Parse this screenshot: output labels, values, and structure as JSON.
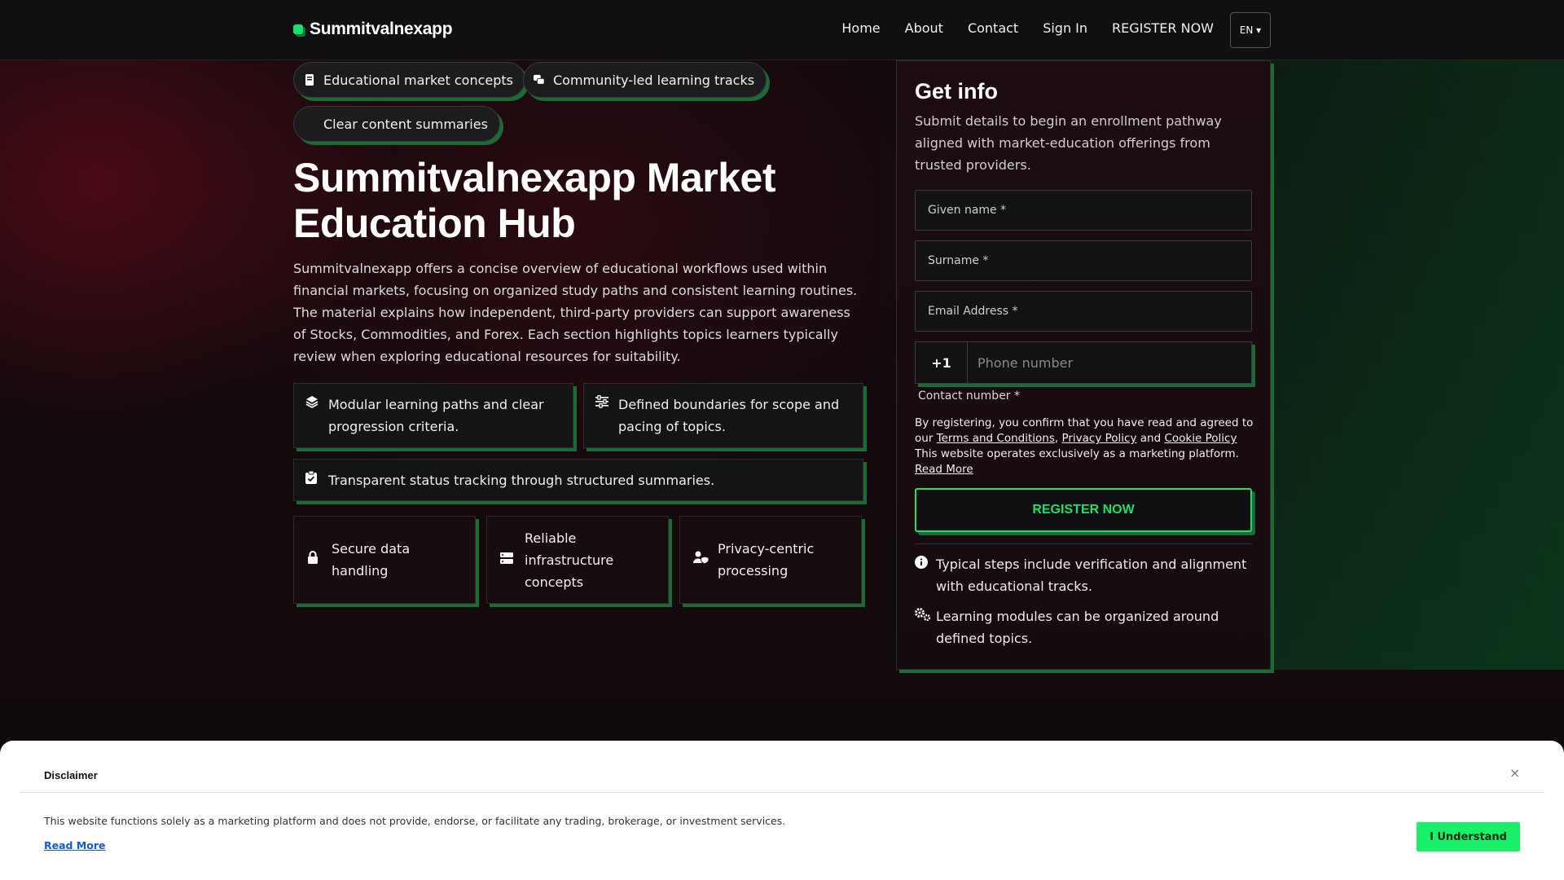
{
  "header": {
    "brand": "Summitvalnexapp",
    "nav": [
      "Home",
      "About",
      "Contact",
      "Sign In",
      "REGISTER NOW"
    ],
    "lang": "EN ▾"
  },
  "chips": [
    {
      "label": "Educational market concepts",
      "icon": "book-icon"
    },
    {
      "label": "Community-led learning tracks",
      "icon": "chat-icon"
    },
    {
      "label": "Clear content summaries",
      "icon": "summary-icon"
    }
  ],
  "hero": {
    "title": "Summitvalnexapp Market Education Hub",
    "description": "Summitvalnexapp offers a concise overview of educational workflows used within financial markets, focusing on organized study paths and consistent learning routines. The material explains how independent, third-party providers can support awareness of Stocks, Commodities, and Forex. Each section highlights topics learners typically review when exploring educational resources for suitability."
  },
  "features": [
    {
      "text": "Modular learning paths and clear progression criteria.",
      "icon": "layers-icon"
    },
    {
      "text": "Defined boundaries for scope and pacing of topics.",
      "icon": "sliders-icon"
    },
    {
      "text": "Transparent status tracking through structured summaries.",
      "icon": "clipboard-check-icon"
    }
  ],
  "mini_features": [
    {
      "text": "Secure data handling",
      "icon": "lock-icon"
    },
    {
      "text": "Reliable infrastructure concepts",
      "icon": "server-icon"
    },
    {
      "text": "Privacy-centric processing",
      "icon": "user-shield-icon"
    }
  ],
  "form": {
    "title": "Get info",
    "subtitle": "Submit details to begin an enrollment pathway aligned with market-education offerings from trusted providers.",
    "given_name": "Given name *",
    "surname": "Surname *",
    "email": "Email Address *",
    "country_code": "+1",
    "phone_placeholder": "Phone number",
    "phone_label": "Contact number *",
    "consent_prefix": "By registering, you confirm that you have read and agreed to our",
    "terms": "Terms and Conditions",
    "privacy": "Privacy Policy",
    "and": "and",
    "cookie": "Cookie Policy",
    "consent_suffix": "This website operates exclusively as a marketing platform.",
    "read_more": "Read More",
    "submit": "REGISTER NOW",
    "notes": [
      {
        "text": "Typical steps include verification and alignment with educational tracks.",
        "icon": "info-icon"
      },
      {
        "text": "Learning modules can be organized around defined topics.",
        "icon": "cogs-icon"
      }
    ]
  },
  "disclaimer": {
    "title": "Disclaimer",
    "text": "This website functions solely as a marketing platform and does not provide, endorse, or facilitate any trading, brokerage, or investment services.",
    "read_more": "Read More",
    "button": "I Understand",
    "close": "×"
  },
  "colors": {
    "accent": "#19e06a",
    "accent_shadow": "#1a6b36",
    "background": "#0d0d0f"
  }
}
